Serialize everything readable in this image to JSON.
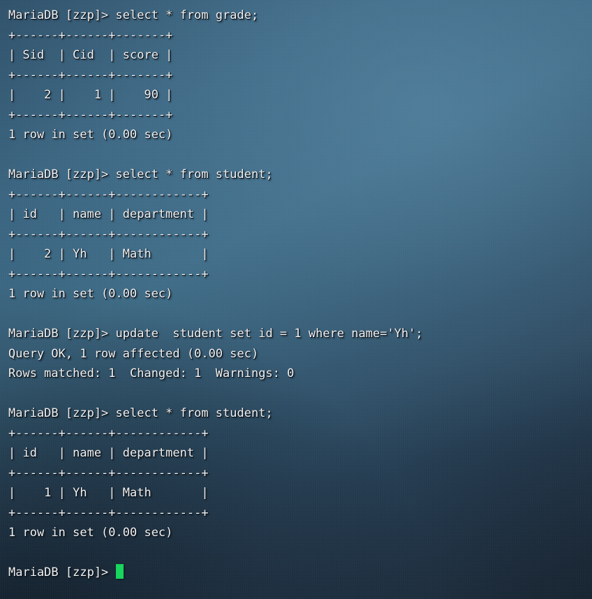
{
  "terminal": {
    "app": "MariaDB client",
    "prompt": "MariaDB [zzp]>",
    "database": "zzp",
    "colors": {
      "text": "#f2f2f2",
      "cursor": "#18d55d",
      "background_light": "#3a6782",
      "background_dark": "#1c2836"
    },
    "cursor_glyph": "block-cursor"
  },
  "lines": [
    "MariaDB [zzp]> select * from grade;",
    "+------+------+-------+",
    "| Sid  | Cid  | score |",
    "+------+------+-------+",
    "|    2 |    1 |    90 |",
    "+------+------+-------+",
    "1 row in set (0.00 sec)",
    "",
    "MariaDB [zzp]> select * from student;",
    "+------+------+------------+",
    "| id   | name | department |",
    "+------+------+------------+",
    "|    2 | Yh   | Math       |",
    "+------+------+------------+",
    "1 row in set (0.00 sec)",
    "",
    "MariaDB [zzp]> update  student set id = 1 where name='Yh';",
    "Query OK, 1 row affected (0.00 sec)",
    "Rows matched: 1  Changed: 1  Warnings: 0",
    "",
    "MariaDB [zzp]> select * from student;",
    "+------+------+------------+",
    "| id   | name | department |",
    "+------+------+------------+",
    "|    1 | Yh   | Math       |",
    "+------+------+------------+",
    "1 row in set (0.00 sec)",
    ""
  ],
  "final_prompt": "MariaDB [zzp]> ",
  "queries": [
    {
      "statement": "select * from grade;",
      "table": "grade",
      "columns": [
        "Sid",
        "Cid",
        "score"
      ],
      "rows": [
        [
          "2",
          "1",
          "90"
        ]
      ],
      "status": "1 row in set (0.00 sec)"
    },
    {
      "statement": "select * from student;",
      "table": "student",
      "columns": [
        "id",
        "name",
        "department"
      ],
      "rows": [
        [
          "2",
          "Yh",
          "Math"
        ]
      ],
      "status": "1 row in set (0.00 sec)"
    },
    {
      "statement": "update  student set id = 1 where name='Yh';",
      "table": "student",
      "status": "Query OK, 1 row affected (0.00 sec)",
      "detail": "Rows matched: 1  Changed: 1  Warnings: 0"
    },
    {
      "statement": "select * from student;",
      "table": "student",
      "columns": [
        "id",
        "name",
        "department"
      ],
      "rows": [
        [
          "1",
          "Yh",
          "Math"
        ]
      ],
      "status": "1 row in set (0.00 sec)"
    }
  ]
}
